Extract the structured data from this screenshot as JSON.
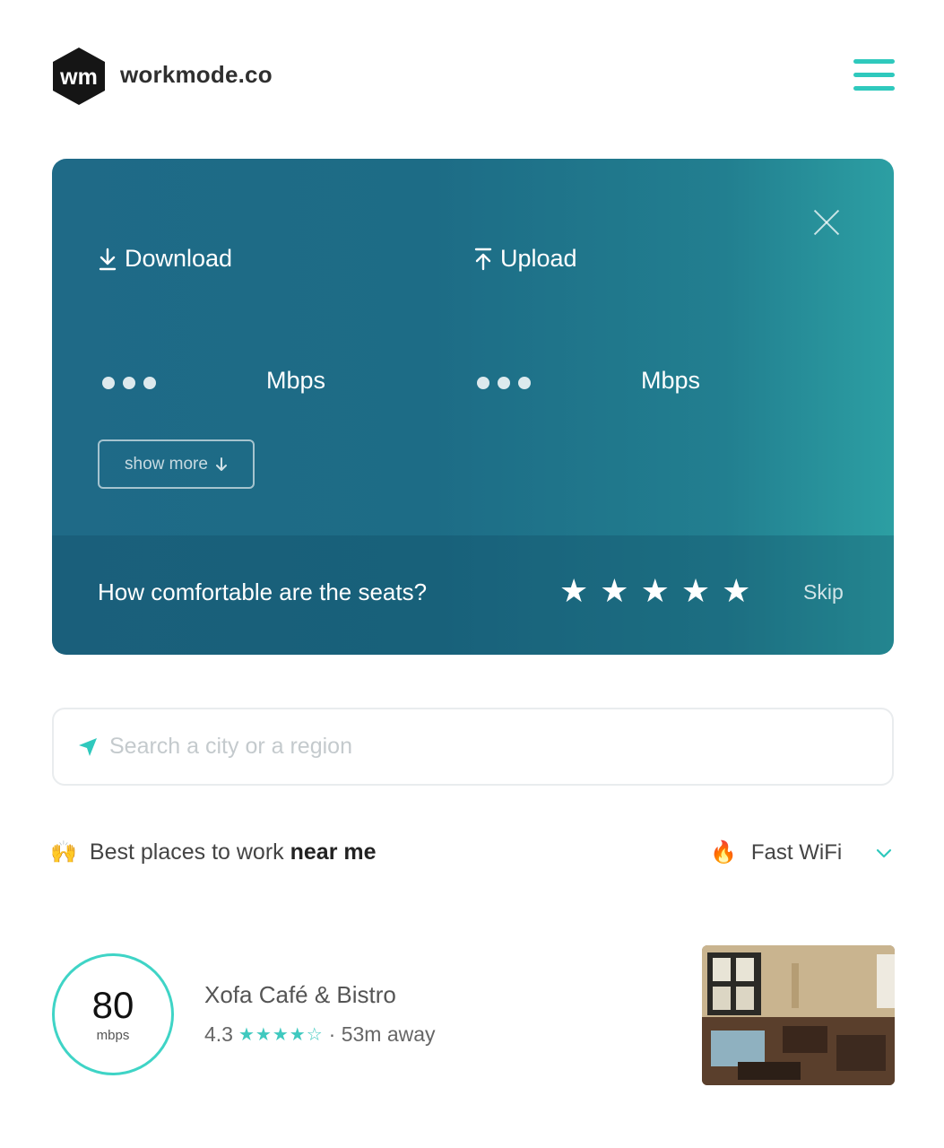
{
  "header": {
    "brand": "workmode.co",
    "logo_text": "wm",
    "menu_icon": "hamburger-icon"
  },
  "colors": {
    "accent": "#2fc9bd",
    "card_start": "#1f6a87",
    "card_end": "#2c9fa3",
    "star_rating": "#3fc9bf"
  },
  "speed_card": {
    "download_label": "Download",
    "upload_label": "Upload",
    "download_unit": "Mbps",
    "upload_unit": "Mbps",
    "show_more_label": "show more",
    "question": "How comfortable are the seats?",
    "skip_label": "Skip",
    "star_count": 5
  },
  "search": {
    "placeholder": "Search a city or a region"
  },
  "section": {
    "title_prefix": "Best places to work",
    "title_emphasis": "near me",
    "filter_label": "Fast WiFi"
  },
  "listing": {
    "speed_value": "80",
    "speed_unit": "mbps",
    "name": "Xofa Café & Bistro",
    "rating": "4.3",
    "rating_stars": "★★★★☆",
    "distance": "· 53m away"
  }
}
